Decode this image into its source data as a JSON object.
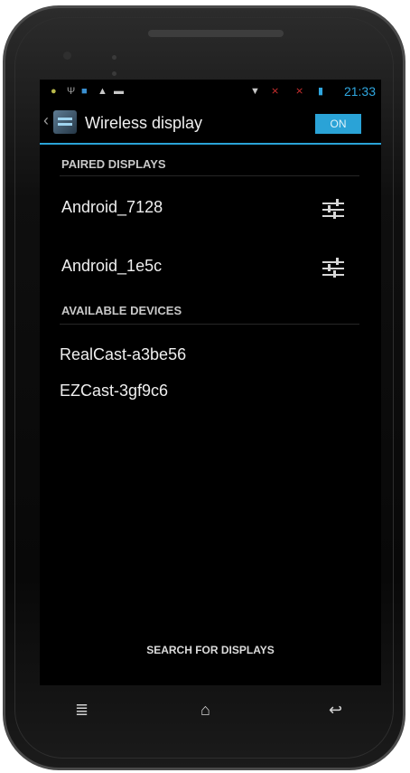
{
  "status": {
    "time": "21:33",
    "icons": [
      "android-icon",
      "usb-icon",
      "image-icon",
      "warning-icon",
      "chat-icon",
      "wifi-icon",
      "no-signal-icon",
      "no-signal-icon",
      "battery-icon"
    ]
  },
  "actionbar": {
    "title": "Wireless display",
    "toggle_label": "ON"
  },
  "paired": {
    "header": "PAIRED DISPLAYS",
    "items": [
      "Android_7128",
      "Android_1e5c"
    ]
  },
  "available": {
    "header": "AVAILABLE DEVICES",
    "items": [
      "RealCast-a3be56",
      "EZCast-3gf9c6"
    ]
  },
  "footer": {
    "search_label": "SEARCH FOR DISPLAYS"
  },
  "nav": {
    "recent_icon": "menu-icon",
    "home_icon": "home-icon",
    "back_icon": "back-icon"
  },
  "colors": {
    "accent": "#2aa3d7",
    "background": "#000000",
    "text": "#efefef"
  }
}
